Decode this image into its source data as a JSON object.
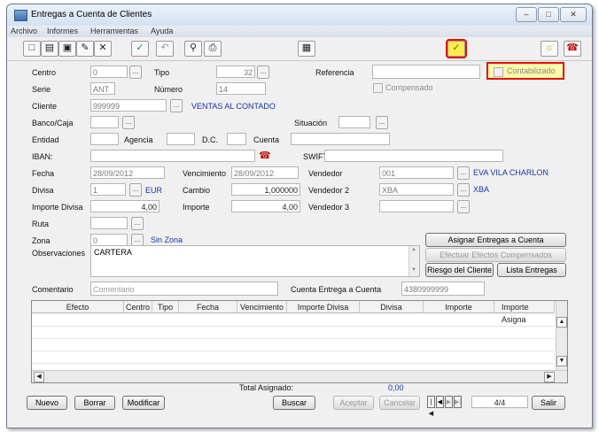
{
  "window": {
    "title": "Entregas a Cuenta de Clientes"
  },
  "menu": {
    "items": [
      "Archivo",
      "Informes",
      "Herramientas",
      "Ayuda"
    ]
  },
  "form": {
    "centro_label": "Centro",
    "centro_value": "0",
    "tipo_label": "Tipo",
    "tipo_value": "32",
    "referencia_label": "Referencia",
    "referencia_value": "",
    "contabilizado_label": "Contabilizado",
    "compensado_label": "Compensado",
    "serie_label": "Serie",
    "serie_value": "ANT",
    "numero_label": "Número",
    "numero_value": "14",
    "cliente_label": "Cliente",
    "cliente_value": "999999",
    "cliente_name": "VENTAS AL CONTADO",
    "banco_label": "Banco/Caja",
    "banco_value": "",
    "situacion_label": "Situación",
    "situacion_value": "",
    "entidad_label": "Entidad",
    "agencia_label": "Agencia",
    "dc_label": "D.C.",
    "cuenta_label": "Cuenta",
    "iban_label": "IBAN:",
    "swift_label": "SWIFT:",
    "fecha_label": "Fecha",
    "fecha_value": "28/09/2012",
    "vencimiento_label": "Vencimiento",
    "vencimiento_value": "28/09/2012",
    "vendedor_label": "Vendedor",
    "vendedor_value": "001",
    "vendedor_name": "EVA VILA CHARLON",
    "divisa_label": "Divisa",
    "divisa_value": "1",
    "divisa_name": "EUR",
    "cambio_label": "Cambio",
    "cambio_value": "1,000000",
    "vendedor2_label": "Vendedor 2",
    "vendedor2_value": "XBA",
    "vendedor2_name": "XBA",
    "importe_divisa_label": "Importe Divisa",
    "importe_divisa_value": "4,00",
    "importe_label": "Importe",
    "importe_value": "4,00",
    "vendedor3_label": "Vendedor 3",
    "vendedor3_value": "",
    "ruta_label": "Ruta",
    "ruta_value": "",
    "zona_label": "Zona",
    "zona_value": "0",
    "zona_name": "Sin Zona",
    "observaciones_label": "Observaciones",
    "observaciones_value": "CARTERA",
    "comentario_label": "Comentario",
    "comentario_placeholder": "Comentario",
    "cuenta_entrega_label": "Cuenta Entrega a Cuenta",
    "cuenta_entrega_value": "4380999999"
  },
  "buttons": {
    "asignar": "Asignar Entregas a Cuenta",
    "efectuar": "Efectuar Efectos Compensados",
    "riesgo": "Riesgo del Cliente",
    "lista": "Lista Entregas",
    "nuevo": "Nuevo",
    "borrar": "Borrar",
    "modificar": "Modificar",
    "buscar": "Buscar",
    "aceptar": "Aceptar",
    "cancelar": "Cancelar",
    "salir": "Salir"
  },
  "grid": {
    "columns": [
      "Efecto",
      "Centro",
      "Tipo",
      "Fecha",
      "Vencimiento",
      "Importe Divisa",
      "Divisa",
      "Importe",
      "Importe Asigna"
    ]
  },
  "totals": {
    "label": "Total Asignado:",
    "value": "0,00"
  },
  "nav": {
    "position": "4/4"
  }
}
